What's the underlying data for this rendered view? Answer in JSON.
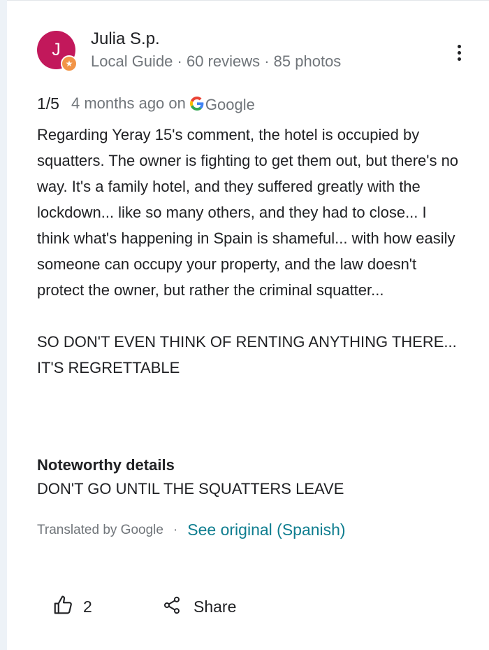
{
  "reviewer": {
    "initial": "J",
    "name": "Julia S.p.",
    "meta": "Local Guide · 60 reviews · 85 photos",
    "avatar_color": "#c2185b",
    "badge_icon": "local-guide-star-icon"
  },
  "review": {
    "rating": "1/5",
    "time": "4 months ago on",
    "source": "Google",
    "paragraph1": "Regarding Yeray 15's comment, the hotel is occupied by squatters. The owner is fighting to get them out, but there's no way. It's a family hotel, and they suffered greatly with the lockdown... like so many others, and they had to close... I think what's happening in Spain is shameful... with how easily someone can occupy your property, and the law doesn't protect the owner, but rather the criminal squatter...",
    "paragraph2": "SO DON'T EVEN THINK OF RENTING ANYTHING THERE... IT'S REGRETTABLE"
  },
  "details": {
    "heading": "Noteworthy details",
    "text": "DON'T GO UNTIL THE SQUATTERS LEAVE"
  },
  "translation": {
    "translated_by": "Translated by Google",
    "separator": "·",
    "see_original": "See original (Spanish)",
    "link_color": "#0e7d8f"
  },
  "actions": {
    "like_count": "2",
    "share_label": "Share"
  },
  "icons": [
    "more-vert-icon",
    "google-g-icon",
    "thumbs-up-icon",
    "share-icon"
  ]
}
